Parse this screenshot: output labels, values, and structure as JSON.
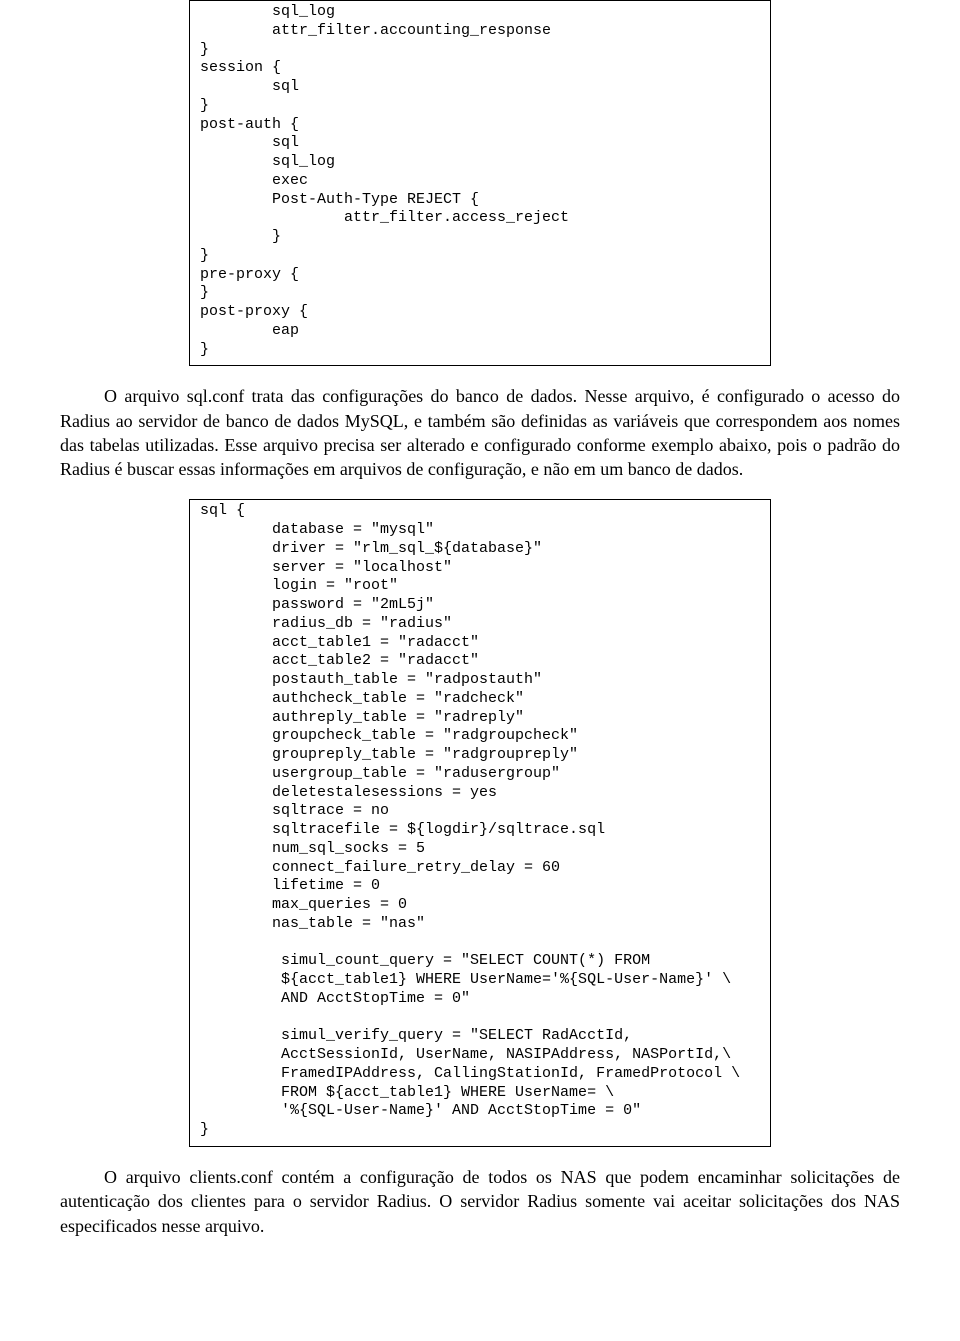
{
  "codeBlock1": "        sql_log\n        attr_filter.accounting_response\n}\nsession {\n        sql\n}\npost-auth {\n        sql\n        sql_log\n        exec\n        Post-Auth-Type REJECT {\n                attr_filter.access_reject\n        }\n}\npre-proxy {\n}\npost-proxy {\n        eap\n}",
  "paragraph1": "O arquivo sql.conf trata das configurações do banco de dados. Nesse arquivo, é configurado o acesso do Radius ao servidor de banco de dados MySQL, e também são definidas as variáveis que correspondem aos nomes das tabelas utilizadas. Esse arquivo precisa ser alterado e configurado conforme exemplo abaixo, pois o padrão do Radius é buscar essas informações em arquivos de configuração, e não em um banco de dados.",
  "codeBlock2": "sql {\n        database = \"mysql\"\n        driver = \"rlm_sql_${database}\"\n        server = \"localhost\"\n        login = \"root\"\n        password = \"2mL5j\"\n        radius_db = \"radius\"\n        acct_table1 = \"radacct\"\n        acct_table2 = \"radacct\"\n        postauth_table = \"radpostauth\"\n        authcheck_table = \"radcheck\"\n        authreply_table = \"radreply\"\n        groupcheck_table = \"radgroupcheck\"\n        groupreply_table = \"radgroupreply\"\n        usergroup_table = \"radusergroup\"\n        deletestalesessions = yes\n        sqltrace = no\n        sqltracefile = ${logdir}/sqltrace.sql\n        num_sql_socks = 5\n        connect_failure_retry_delay = 60\n        lifetime = 0\n        max_queries = 0\n        nas_table = \"nas\"\n\n         simul_count_query = \"SELECT COUNT(*) FROM\n         ${acct_table1} WHERE UserName='%{SQL-User-Name}' \\\n         AND AcctStopTime = 0\"\n\n         simul_verify_query = \"SELECT RadAcctId,\n         AcctSessionId, UserName, NASIPAddress, NASPortId,\\\n         FramedIPAddress, CallingStationId, FramedProtocol \\\n         FROM ${acct_table1} WHERE UserName= \\\n         '%{SQL-User-Name}' AND AcctStopTime = 0\"\n}",
  "paragraph2": "O arquivo clients.conf contém a configuração de todos os NAS que podem encaminhar solicitações de autenticação dos clientes para o servidor Radius. O servidor Radius somente vai aceitar solicitações dos NAS especificados nesse arquivo."
}
